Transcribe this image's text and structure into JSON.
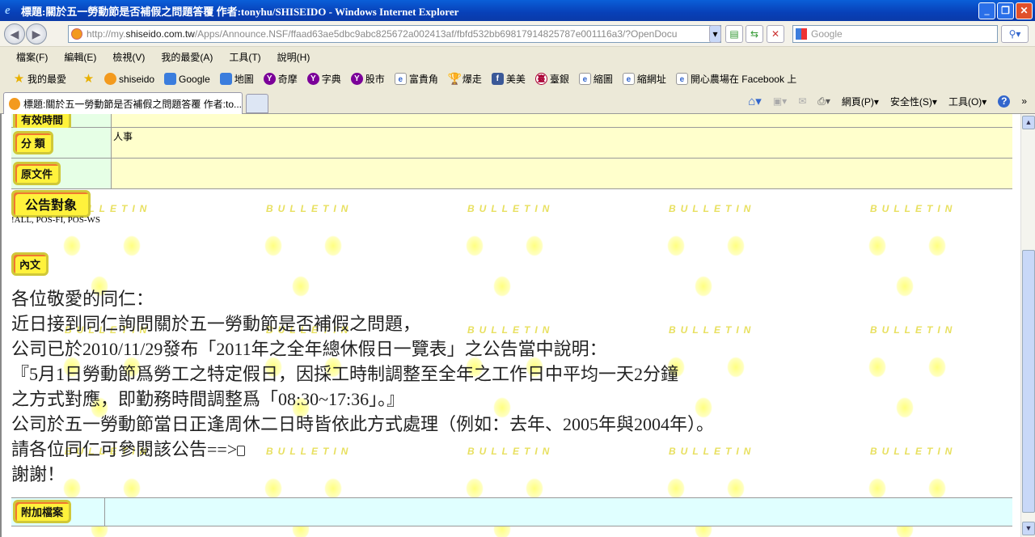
{
  "window": {
    "title": "標題:關於五一勞動節是否補假之問題答覆 作者:tonyhu/SHISEIDO - Windows Internet Explorer"
  },
  "address": {
    "url_prefix": "http://my.",
    "url_domain": "shiseido.com.tw",
    "url_rest": "/Apps/Announce.NSF/ffaad63ae5dbc9abc825672a002413af/fbfd532bb69817914825787e001116a3/?OpenDocu",
    "search_placeholder": "Google"
  },
  "menu": [
    "檔案(F)",
    "編輯(E)",
    "檢視(V)",
    "我的最愛(A)",
    "工具(T)",
    "說明(H)"
  ],
  "favorites": {
    "label": "我的最愛",
    "items": [
      "shiseido",
      "Google",
      "地圖",
      "奇摩",
      "字典",
      "股市",
      "富貴角",
      "爆走",
      "美美",
      "臺銀",
      "縮圖",
      "縮網址",
      "開心農場在 Facebook 上"
    ]
  },
  "tab": {
    "title": "標題:關於五一勞動節是否補假之問題答覆 作者:to..."
  },
  "commands": {
    "page": "網頁(P)",
    "safety": "安全性(S)",
    "tools": "工具(O)"
  },
  "document": {
    "fields": [
      {
        "label": "有效時間",
        "value": ""
      },
      {
        "label": "分 類",
        "value": "人事"
      },
      {
        "label": "原文件",
        "value": ""
      }
    ],
    "audience_label": "公告對象",
    "audience_value": "!ALL, POS-FI, POS-WS",
    "content_label": "內文",
    "body_lines": [
      "各位敬愛的同仁：",
      "近日接到同仁詢問關於五一勞動節是否補假之問題，",
      "公司已於2010/11/29發布「2011年之全年總休假日一覽表」之公告當中說明：",
      "『5月1日勞動節爲勞工之特定假日，因採工時制調整至全年之工作日中平均一天2分鐘",
      "之方式對應，即勤務時間調整爲「08:30~17:36」。』",
      "公司於五一勞動節當日正逢周休二日時皆依此方式處理（例如：去年、2005年與2004年）。",
      "請各位同仁可參閱該公告==>",
      "謝謝！"
    ],
    "attachment_label": "附加檔案",
    "watermark": "BULLETIN"
  }
}
